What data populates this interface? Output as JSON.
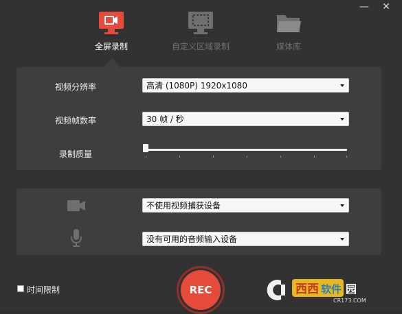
{
  "window": {
    "minimize": "—",
    "close": "✕"
  },
  "tabs": [
    {
      "label": "全屏录制",
      "icon": "monitor-record-icon",
      "active": true
    },
    {
      "label": "自定义区域录制",
      "icon": "region-select-icon",
      "active": false
    },
    {
      "label": "媒体库",
      "icon": "folder-icon",
      "active": false
    }
  ],
  "video": {
    "resolution_label": "视频分辨率",
    "resolution_value": "高清 (1080P)   1920x1080",
    "framerate_label": "视频帧数率",
    "framerate_value": "30 帧 / 秒",
    "quality_label": "录制质量",
    "quality_level": 0
  },
  "devices": {
    "camera_icon": "camera-icon",
    "camera_value": "不使用视频捕获设备",
    "mic_icon": "microphone-icon",
    "mic_value": "没有可用的音频输入设备"
  },
  "rec": {
    "label": "REC"
  },
  "time_limit": {
    "label": "时间限制",
    "checked": false
  },
  "watermark": {
    "brand": "西西软件园",
    "site": "CR173.COM"
  },
  "colors": {
    "accent": "#e64a3b",
    "panel": "#3e3e3e",
    "background": "#323232"
  }
}
